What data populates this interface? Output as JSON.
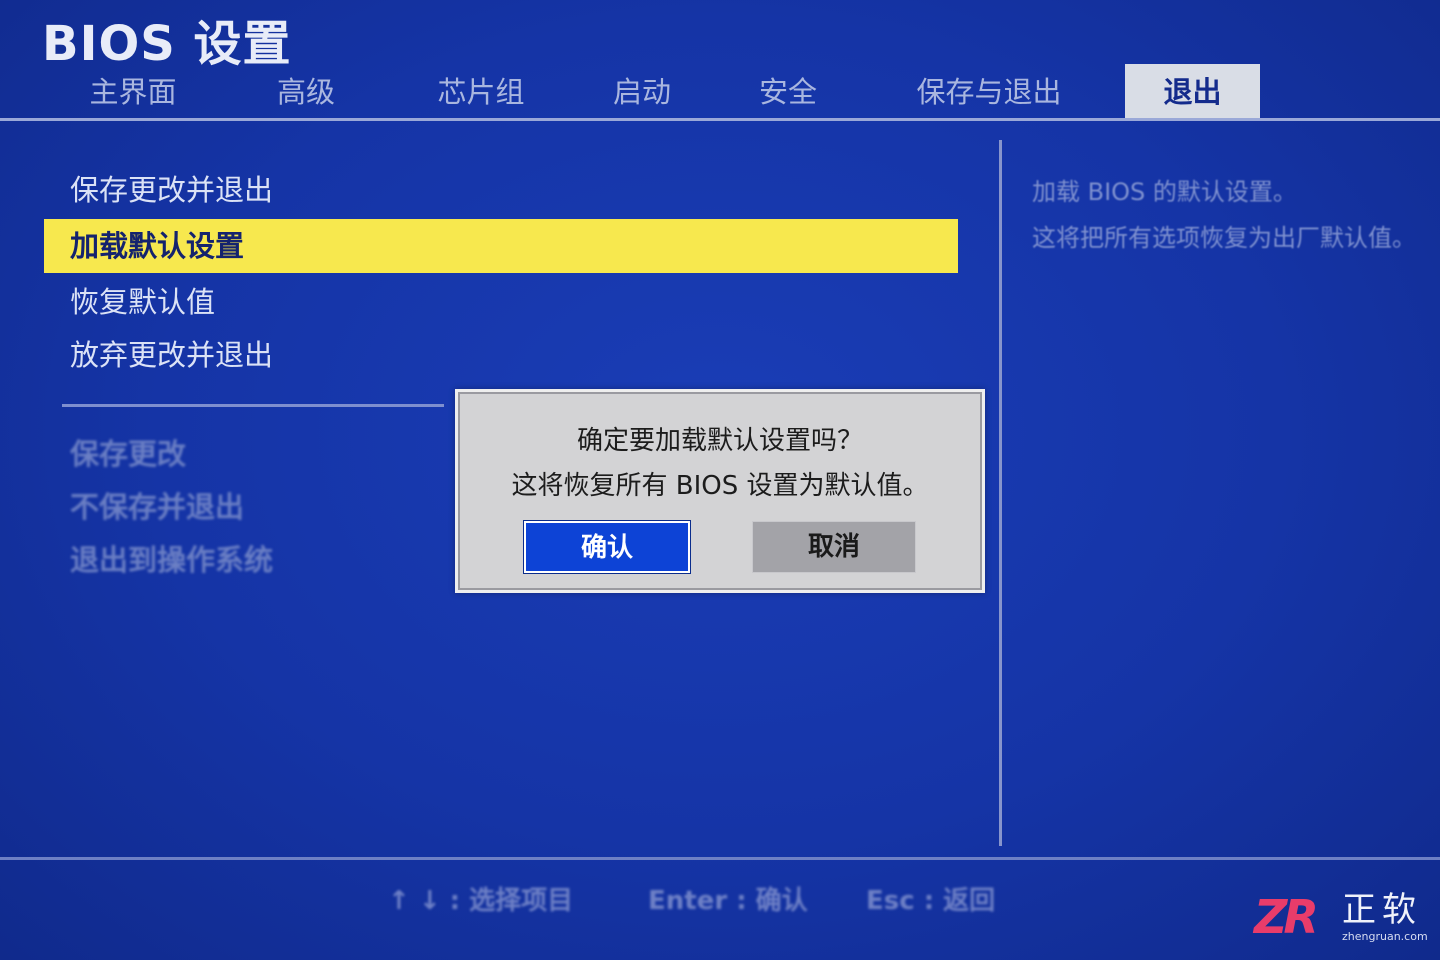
{
  "header": {
    "title": "BIOS 设置"
  },
  "tabs": [
    {
      "label": "主界面",
      "active": false
    },
    {
      "label": "高级",
      "active": false
    },
    {
      "label": "芯片组",
      "active": false
    },
    {
      "label": "启动",
      "active": false
    },
    {
      "label": "安全",
      "active": false
    },
    {
      "label": "保存与退出",
      "active": false
    },
    {
      "label": "退出",
      "active": true
    }
  ],
  "menu": {
    "items": [
      {
        "label": "保存更改并退出",
        "state": "normal"
      },
      {
        "label": "加载默认设置",
        "state": "selected"
      },
      {
        "label": "恢复默认值",
        "state": "normal"
      },
      {
        "label": "放弃更改并退出",
        "state": "normal"
      }
    ],
    "dim_items": [
      {
        "label": "保存更改",
        "state": "disabled"
      },
      {
        "label": "不保存并退出",
        "state": "disabled"
      },
      {
        "label": "退出到操作系统",
        "state": "disabled"
      }
    ]
  },
  "help": {
    "line1": "加载 BIOS 的默认设置。",
    "line2": "这将把所有选项恢复为出厂默认值。"
  },
  "dialog": {
    "question": "确定要加载默认设置吗？",
    "detail": "这将恢复所有 BIOS 设置为默认值。",
    "confirm_label": "确认",
    "cancel_label": "取消",
    "focused_button": "confirm"
  },
  "footer": {
    "navigate": "↑ ↓ : 选择项目",
    "enter": "Enter : 确认",
    "esc": "Esc : 返回"
  },
  "watermark": {
    "mark": "ZR",
    "name": "正软",
    "domain": "zhengruan.com"
  },
  "colors": {
    "background": "#1534a6",
    "highlight": "#f7e84e",
    "active_tab": "#d9dde6",
    "confirm_button": "#0d43d6",
    "dialog_bg": "#d3d3d5"
  }
}
